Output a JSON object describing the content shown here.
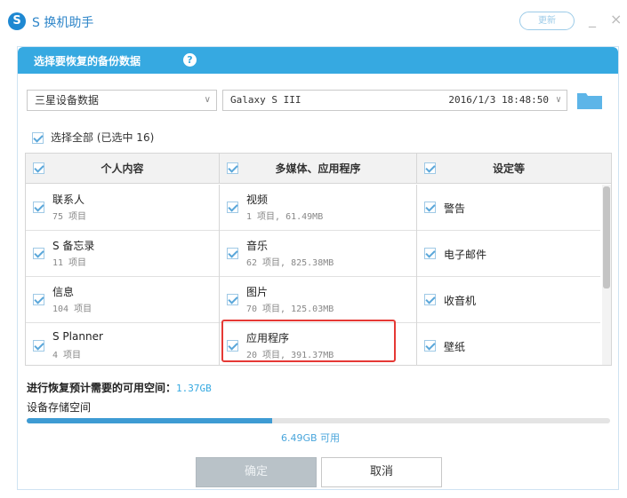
{
  "app": {
    "logo": "S",
    "title": "S 换机助手",
    "version_button": "更新",
    "minimize": "_",
    "close": "×"
  },
  "panel": {
    "title": "选择要恢复的备份数据",
    "help": "?"
  },
  "device_select": {
    "value": "三星设备数据"
  },
  "backup_select": {
    "device": "Galaxy S III",
    "date": "2016/1/3 18:48:50"
  },
  "select_all": {
    "label": "选择全部 (已选中 16)"
  },
  "columns": [
    "个人内容",
    "多媒体、应用程序",
    "设定等"
  ],
  "rows": [
    {
      "c1": {
        "name": "联系人",
        "sub": "75 项目"
      },
      "c2": {
        "name": "视频",
        "sub": "1 项目, 61.49MB"
      },
      "c3": {
        "name": "警告"
      }
    },
    {
      "c1": {
        "name": "S 备忘录",
        "sub": "11 项目"
      },
      "c2": {
        "name": "音乐",
        "sub": "62 项目, 825.38MB"
      },
      "c3": {
        "name": "电子邮件"
      }
    },
    {
      "c1": {
        "name": "信息",
        "sub": "104 项目"
      },
      "c2": {
        "name": "图片",
        "sub": "70 项目, 125.03MB"
      },
      "c3": {
        "name": "收音机"
      }
    },
    {
      "c1": {
        "name": "S Planner",
        "sub": "4 项目"
      },
      "c2": {
        "name": "应用程序",
        "sub": "20 项目, 391.37MB"
      },
      "c3": {
        "name": "壁纸"
      }
    }
  ],
  "required_space": {
    "label": "进行恢复预计需要的可用空间：",
    "value": "1.37GB"
  },
  "storage": {
    "label": "设备存储空间",
    "available": "6.49GB 可用",
    "used_fraction": 0.42
  },
  "buttons": {
    "ok": "确定",
    "cancel": "取消"
  },
  "colors": {
    "accent": "#36a9e1",
    "highlight": "#e53935",
    "progress": "#3e9bd3"
  }
}
